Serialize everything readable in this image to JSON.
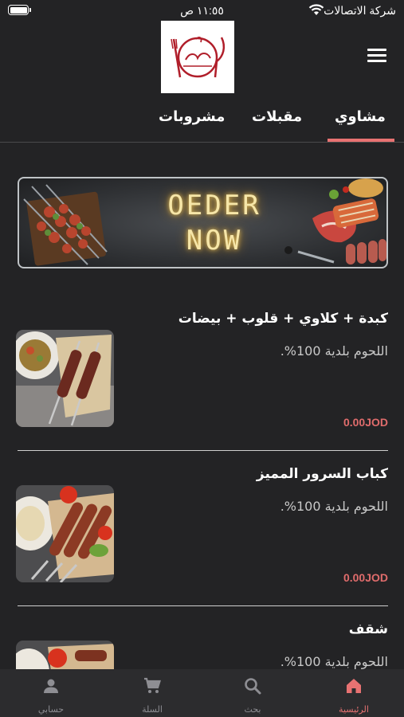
{
  "status_bar": {
    "time": "١١:٥٥ ص",
    "carrier": "شركة الاتصالات"
  },
  "header": {
    "logo_text": "السرور"
  },
  "tabs": [
    {
      "label": "مشاوي",
      "active": true
    },
    {
      "label": "مقبلات",
      "active": false
    },
    {
      "label": "مشروبات",
      "active": false
    }
  ],
  "banner": {
    "line1": "OEDER",
    "line2": "NOW"
  },
  "menu_items": [
    {
      "title": "كبدة + كلاوي + قلوب + بيضات",
      "description": "اللحوم بلدية 100%.",
      "price": "0.00JOD"
    },
    {
      "title": "كباب السرور المميز",
      "description": "اللحوم بلدية 100%.",
      "price": "0.00JOD"
    },
    {
      "title": "شقف",
      "description": "اللحوم بلدية 100%.",
      "price": ""
    }
  ],
  "bottom_nav": [
    {
      "label": "الرئيسية",
      "icon": "home-icon",
      "active": true
    },
    {
      "label": "بحث",
      "icon": "search-icon",
      "active": false
    },
    {
      "label": "السلة",
      "icon": "cart-icon",
      "active": false
    },
    {
      "label": "حسابي",
      "icon": "profile-icon",
      "active": false
    }
  ],
  "colors": {
    "background": "#232325",
    "accent": "#e87272",
    "price": "#e06c6c",
    "nav_background": "#2c2c2e"
  }
}
